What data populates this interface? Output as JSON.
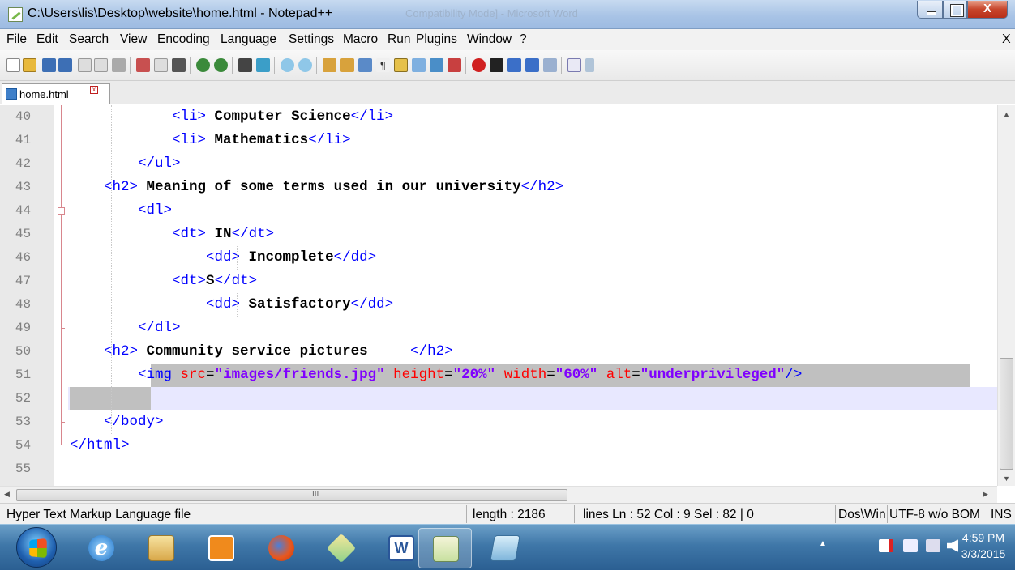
{
  "window": {
    "title": "C:\\Users\\lis\\Desktop\\website\\home.html - Notepad++",
    "ghost_title": "Compatibility Mode] - Microsoft Word",
    "close_glyph": "X"
  },
  "menu": {
    "items": [
      "File",
      "Edit",
      "Search",
      "View",
      "Encoding",
      "Language",
      "Settings",
      "Macro",
      "Run",
      "Plugins",
      "Window",
      "?"
    ],
    "close_glyph": "X"
  },
  "tab": {
    "label": "home.html",
    "close_glyph": "x"
  },
  "editor": {
    "current_line": 52,
    "lines": [
      {
        "num": "40",
        "indent": "            ",
        "parts": [
          [
            "tag",
            "<li>"
          ],
          [
            "txt",
            " Computer Science"
          ],
          [
            "tag",
            "</li>"
          ]
        ]
      },
      {
        "num": "41",
        "indent": "            ",
        "parts": [
          [
            "tag",
            "<li>"
          ],
          [
            "txt",
            " Mathematics"
          ],
          [
            "tag",
            "</li>"
          ]
        ]
      },
      {
        "num": "42",
        "indent": "        ",
        "parts": [
          [
            "tag",
            "</ul>"
          ]
        ]
      },
      {
        "num": "43",
        "indent": "    ",
        "parts": [
          [
            "tag",
            "<h2>"
          ],
          [
            "txt",
            " Meaning of some terms used in our university"
          ],
          [
            "tag",
            "</h2>"
          ]
        ]
      },
      {
        "num": "44",
        "indent": "        ",
        "parts": [
          [
            "tag",
            "<dl>"
          ]
        ]
      },
      {
        "num": "45",
        "indent": "            ",
        "parts": [
          [
            "tag",
            "<dt>"
          ],
          [
            "txt",
            " IN"
          ],
          [
            "tag",
            "</dt>"
          ]
        ]
      },
      {
        "num": "46",
        "indent": "                ",
        "parts": [
          [
            "tag",
            "<dd>"
          ],
          [
            "txt",
            " Incomplete"
          ],
          [
            "tag",
            "</dd>"
          ]
        ]
      },
      {
        "num": "47",
        "indent": "            ",
        "parts": [
          [
            "tag",
            "<dt>"
          ],
          [
            "txt",
            "S"
          ],
          [
            "tag",
            "</dt>"
          ]
        ]
      },
      {
        "num": "48",
        "indent": "                ",
        "parts": [
          [
            "tag",
            "<dd>"
          ],
          [
            "txt",
            " Satisfactory"
          ],
          [
            "tag",
            "</dd>"
          ]
        ]
      },
      {
        "num": "49",
        "indent": "        ",
        "parts": [
          [
            "tag",
            "</dl>"
          ]
        ]
      },
      {
        "num": "50",
        "indent": "    ",
        "parts": [
          [
            "tag",
            "<h2>"
          ],
          [
            "txt",
            " Community service pictures     "
          ],
          [
            "tag",
            "</h2>"
          ]
        ]
      },
      {
        "num": "51",
        "indent": "        ",
        "parts": [
          [
            "tag",
            "<img "
          ],
          [
            "attr",
            "src"
          ],
          [
            "eq",
            "="
          ],
          [
            "val",
            "\"images/friends.jpg\""
          ],
          [
            "eq",
            " "
          ],
          [
            "attr",
            "height"
          ],
          [
            "eq",
            "="
          ],
          [
            "val",
            "\"20%\""
          ],
          [
            "eq",
            " "
          ],
          [
            "attr",
            "width"
          ],
          [
            "eq",
            "="
          ],
          [
            "val",
            "\"60%\""
          ],
          [
            "eq",
            " "
          ],
          [
            "attr",
            "alt"
          ],
          [
            "eq",
            "="
          ],
          [
            "val",
            "\"underprivileged\""
          ],
          [
            "tag",
            "/>"
          ]
        ]
      },
      {
        "num": "52",
        "indent": "",
        "parts": []
      },
      {
        "num": "53",
        "indent": "    ",
        "parts": [
          [
            "tag",
            "</body>"
          ]
        ]
      },
      {
        "num": "54",
        "indent": "",
        "parts": [
          [
            "tag",
            "</html>"
          ]
        ]
      },
      {
        "num": "55",
        "indent": "",
        "parts": []
      }
    ]
  },
  "scrollbar": {
    "grip": "III"
  },
  "status": {
    "file_type": "Hyper Text Markup Language file",
    "length": "length : 2186",
    "position": "lines Ln : 52    Col : 9    Sel : 82 | 0",
    "eol": "Dos\\Windows",
    "encoding": "UTF-8 w/o BOM",
    "mode": "INS"
  },
  "taskbar": {
    "apps": [
      "internet-explorer",
      "file-explorer",
      "media-player",
      "firefox",
      "folder-sync",
      "microsoft-word",
      "notepad-plus-plus",
      "notepad"
    ],
    "active_app": "notepad-plus-plus",
    "tray_arrow": "▲",
    "time": "4:59 PM",
    "date": "3/3/2015"
  },
  "colors": {
    "tag": "#0000ff",
    "attribute": "#ff0000",
    "value": "#8000ff",
    "text": "#000000",
    "selection": "#c0c0c0",
    "current_line": "#e8e8ff"
  }
}
